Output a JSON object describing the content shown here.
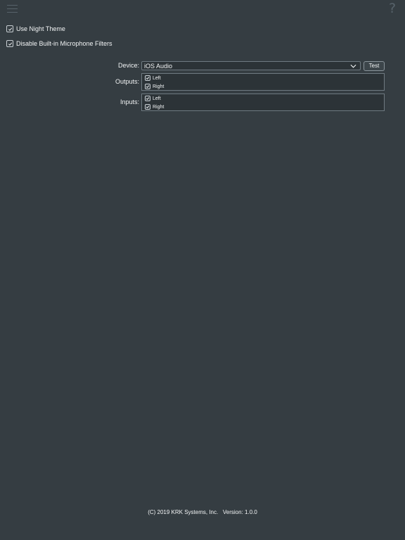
{
  "toolbar": {
    "menu_icon": "hamburger-menu-icon",
    "help_icon": "question-mark-icon",
    "help_glyph": "?"
  },
  "settings": {
    "night_theme": {
      "label": "Use Night Theme",
      "checked": true
    },
    "mic_filters": {
      "label": "Disable Built-in Microphone Filters",
      "checked": true
    }
  },
  "device": {
    "label": "Device:",
    "value": "iOS Audio",
    "test_label": "Test"
  },
  "outputs": {
    "label": "Outputs:",
    "channels": [
      {
        "label": "Left",
        "checked": true
      },
      {
        "label": "Right",
        "checked": true
      }
    ]
  },
  "inputs": {
    "label": "Inputs:",
    "channels": [
      {
        "label": "Left",
        "checked": true
      },
      {
        "label": "Right",
        "checked": true
      }
    ]
  },
  "footer": {
    "copyright": "(C) 2019 KRK Systems, Inc.",
    "version": "Version: 1.0.0"
  },
  "colors": {
    "background": "#353d42",
    "icon": "#57626a",
    "text": "#f2f4f5"
  }
}
